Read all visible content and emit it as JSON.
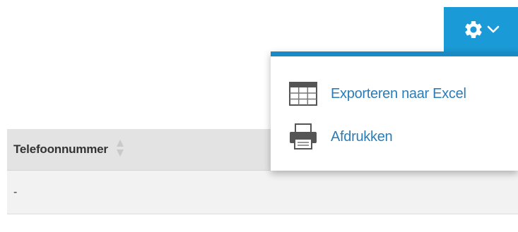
{
  "toolbar": {
    "gear_icon": "gear-icon",
    "chevron_icon": "chevron-down-icon",
    "accent_color": "#1a9ad6"
  },
  "table": {
    "columns": [
      {
        "label": "Telefoonnummer",
        "sort_icon": "sort-icon"
      }
    ],
    "rows": [
      [
        "-"
      ]
    ]
  },
  "dropdown": {
    "border_color": "#1a8ac4",
    "items": [
      {
        "label": "Exporteren naar Excel",
        "icon": "table-grid-icon"
      },
      {
        "label": "Afdrukken",
        "icon": "printer-icon"
      }
    ]
  }
}
